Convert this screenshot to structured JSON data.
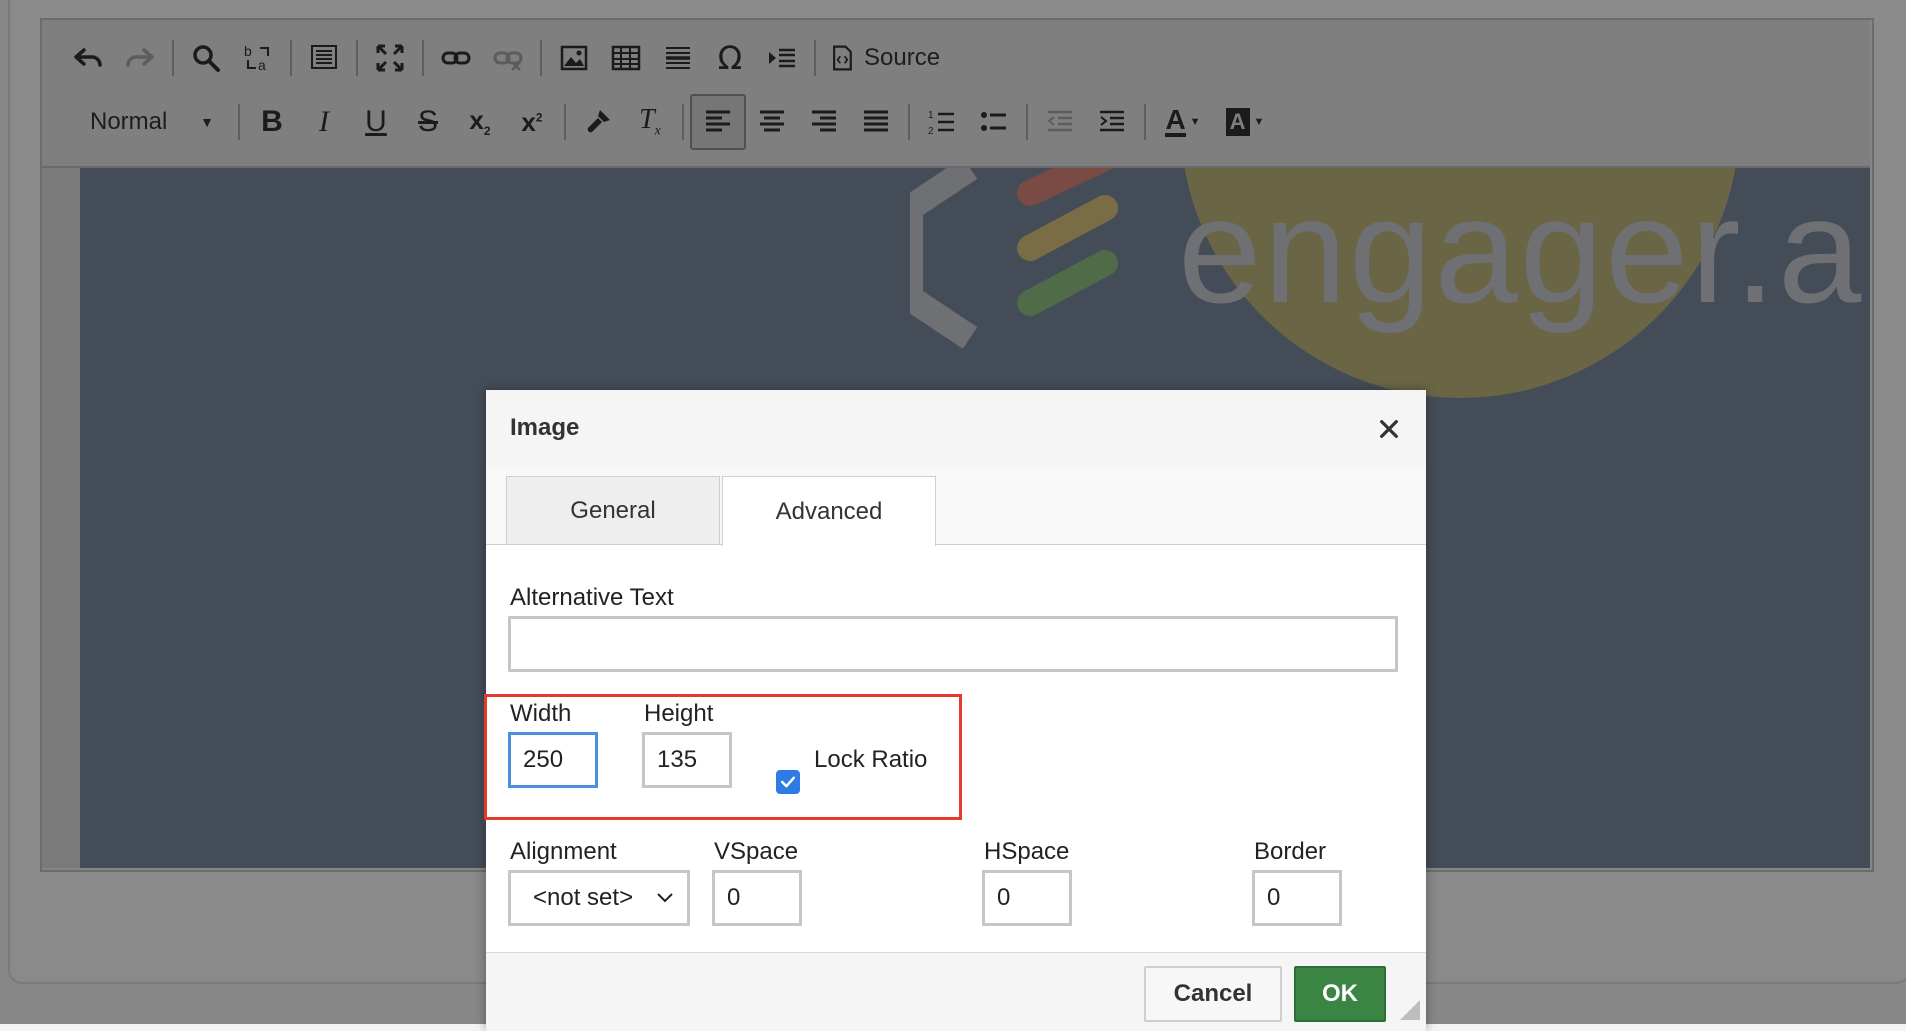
{
  "toolbar": {
    "row1": [
      {
        "name": "undo-icon",
        "glyph": "↶"
      },
      {
        "name": "redo-icon",
        "glyph": "↷"
      },
      {
        "name": "find-icon",
        "glyph": "🔍"
      },
      {
        "name": "replace-icon",
        "glyph": "⇄"
      },
      {
        "name": "select-all-icon",
        "glyph": "▤"
      },
      {
        "name": "maximize-icon",
        "glyph": "⤢"
      },
      {
        "name": "link-icon",
        "glyph": "🔗"
      },
      {
        "name": "unlink-icon",
        "glyph": "⛓"
      },
      {
        "name": "image-icon",
        "glyph": "🖼"
      },
      {
        "name": "table-icon",
        "glyph": "▦"
      },
      {
        "name": "horizontal-line-icon",
        "glyph": "≣"
      },
      {
        "name": "special-char-icon",
        "glyph": "Ω"
      },
      {
        "name": "page-break-icon",
        "glyph": "⇥"
      },
      {
        "name": "source-icon",
        "glyph": "⟨⟩"
      }
    ],
    "source_label": "Source",
    "format_value": "Normal",
    "row2": [
      {
        "name": "bold-icon",
        "glyph": "B"
      },
      {
        "name": "italic-icon",
        "glyph": "I"
      },
      {
        "name": "underline-icon",
        "glyph": "U"
      },
      {
        "name": "strikethrough-icon",
        "glyph": "S"
      },
      {
        "name": "subscript-icon",
        "glyph": "x₂"
      },
      {
        "name": "superscript-icon",
        "glyph": "x²"
      },
      {
        "name": "copy-format-icon",
        "glyph": "🖌"
      },
      {
        "name": "remove-format-icon",
        "glyph": "Tₓ"
      },
      {
        "name": "align-left-icon",
        "glyph": "≡"
      },
      {
        "name": "align-center-icon",
        "glyph": "≡"
      },
      {
        "name": "align-right-icon",
        "glyph": "≡"
      },
      {
        "name": "align-justify-icon",
        "glyph": "≡"
      },
      {
        "name": "numbered-list-icon",
        "glyph": "⒈"
      },
      {
        "name": "bulleted-list-icon",
        "glyph": "•"
      },
      {
        "name": "outdent-icon",
        "glyph": "⇤"
      },
      {
        "name": "indent-icon",
        "glyph": "⇥"
      },
      {
        "name": "text-color-icon",
        "glyph": "A"
      },
      {
        "name": "background-color-icon",
        "glyph": "A"
      }
    ]
  },
  "content": {
    "logo_text": "engager.app"
  },
  "dialog": {
    "title": "Image",
    "tabs": [
      {
        "label": "General",
        "active": false
      },
      {
        "label": "Advanced",
        "active": true
      }
    ],
    "alt_text": {
      "label": "Alternative Text",
      "value": ""
    },
    "width": {
      "label": "Width",
      "value": "250"
    },
    "height": {
      "label": "Height",
      "value": "135"
    },
    "lock_ratio": {
      "label": "Lock Ratio",
      "checked": true
    },
    "alignment": {
      "label": "Alignment",
      "value": "<not set>"
    },
    "vspace": {
      "label": "VSpace",
      "value": "0"
    },
    "hspace": {
      "label": "HSpace",
      "value": "0"
    },
    "border": {
      "label": "Border",
      "value": "0"
    },
    "cancel_label": "Cancel",
    "ok_label": "OK"
  },
  "colors": {
    "ok_button": "#3a8543",
    "highlight": "#e23b2a",
    "focus": "#4a8fe0",
    "checkbox": "#2f7ae5"
  }
}
